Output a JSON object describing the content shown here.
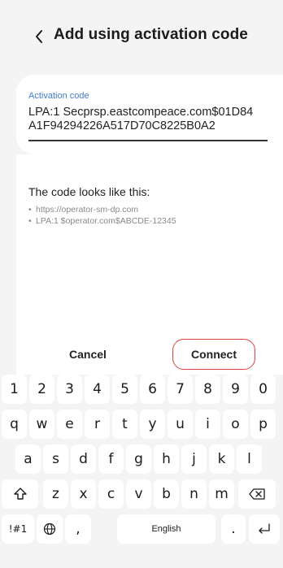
{
  "header": {
    "back_icon": "chevron-left-icon",
    "title": "Add using activation code"
  },
  "activation": {
    "label": "Activation code",
    "value": "LPA:1 Secprsp.eastcompeace.com$01D84A1F94294226A517D70C8225B0A2"
  },
  "hint": {
    "title": "The code looks like this:",
    "examples": [
      "https://operator-sm-dp.com",
      "LPA:1 $operator.com$ABCDE-12345"
    ]
  },
  "actions": {
    "cancel_label": "Cancel",
    "connect_label": "Connect",
    "accent_color": "#e5413e"
  },
  "keyboard": {
    "rows": [
      [
        "1",
        "2",
        "3",
        "4",
        "5",
        "6",
        "7",
        "8",
        "9",
        "0"
      ],
      [
        "q",
        "w",
        "e",
        "r",
        "t",
        "y",
        "u",
        "i",
        "o",
        "p"
      ],
      [
        "a",
        "s",
        "d",
        "f",
        "g",
        "h",
        "j",
        "k",
        "l"
      ],
      [
        "z",
        "x",
        "c",
        "v",
        "b",
        "n",
        "m"
      ]
    ],
    "symbols_key": "!#1",
    "comma_key": ",",
    "space_label": "English",
    "period_key": ".",
    "shift_icon": "shift-icon",
    "backspace_icon": "backspace-icon",
    "globe_icon": "globe-icon",
    "enter_icon": "enter-icon"
  }
}
